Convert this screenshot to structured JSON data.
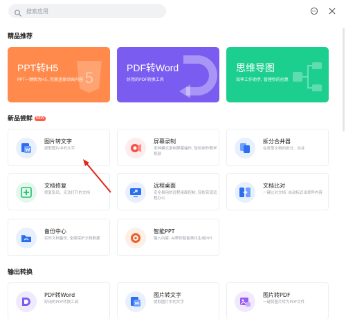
{
  "search": {
    "placeholder": "搜索应用"
  },
  "top_icons": [
    "chat-icon",
    "close-icon"
  ],
  "sections": {
    "featured": "精品推荐",
    "new": "新品尝鲜",
    "new_badge": "NEW",
    "output": "输出转换"
  },
  "banners": [
    {
      "title": "PPT转H5",
      "subtitle": "PPT一键转为H5, 完美还原动画内容",
      "color": "#ff8a4c",
      "icon": "html5-icon"
    },
    {
      "title": "PDF转Word",
      "subtitle": "好用的PDF转换工具",
      "color": "#7a5cf0",
      "icon": "convert-arrow-icon"
    },
    {
      "title": "思维导图",
      "subtitle": "效率工作助手, 管理你的创意",
      "color": "#1ccf8e",
      "icon": "mindmap-icon"
    }
  ],
  "new_items": [
    {
      "title": "图片转文字",
      "desc": "提取图片中的文字",
      "icon": "image-to-text-icon",
      "color": "#2b6ff0"
    },
    {
      "title": "屏幕录制",
      "desc": "多种模式录制屏幕操作, 轻松制作教学视频",
      "icon": "screen-record-icon",
      "color": "#f5504a"
    },
    {
      "title": "拆分合并器",
      "desc": "在类型文档的拆分、合并",
      "icon": "split-merge-icon",
      "color": "#2b6ff0"
    },
    {
      "title": "文档修复",
      "desc": "修复乱码、无法打开的文档",
      "icon": "doc-repair-icon",
      "color": "#1cbf6e"
    },
    {
      "title": "远程桌面",
      "desc": "安全易用的远程桌面控制, 轻松实现远程办公",
      "icon": "remote-desktop-icon",
      "color": "#2b6ff0"
    },
    {
      "title": "文档比对",
      "desc": "一键比对文档, 自动标识出修异内容",
      "icon": "doc-compare-icon",
      "color": "#2b6ff0"
    },
    {
      "title": "备份中心",
      "desc": "实时文档备份, 全面保护文档数据",
      "icon": "backup-icon",
      "color": "#2b6ff0"
    },
    {
      "title": "智能PPT",
      "desc": "输入内容, AI帮你智能美化生成PPT",
      "icon": "smart-ppt-icon",
      "color": "#e8632e"
    }
  ],
  "output_items": [
    {
      "title": "PDF转Word",
      "desc": "好用的PDF转换工具",
      "icon": "pdf-to-word-icon",
      "color": "#7a5cf0"
    },
    {
      "title": "图片转文字",
      "desc": "提取图片中的文字",
      "icon": "image-to-text-icon",
      "color": "#2b6ff0"
    },
    {
      "title": "图片转PDF",
      "desc": "一键将图片转为PDF文件",
      "icon": "image-to-pdf-icon",
      "color": "#9a5cf0"
    }
  ]
}
